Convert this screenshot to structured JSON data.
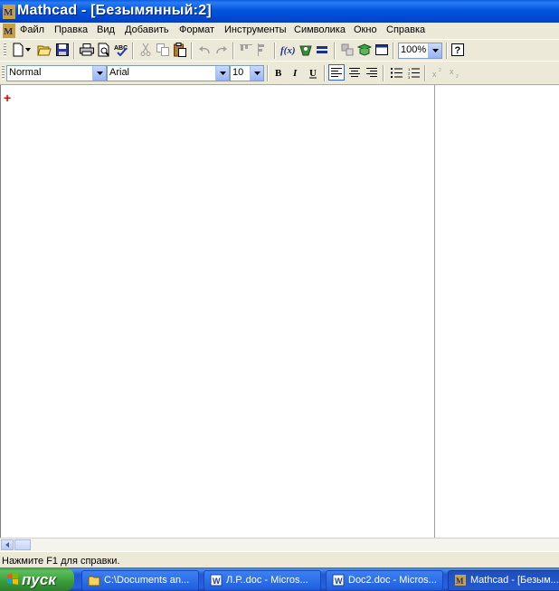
{
  "window": {
    "title": "Mathcad - [Безымянный:2]"
  },
  "menu": [
    "Файл",
    "Правка",
    "Вид",
    "Добавить",
    "Формат",
    "Инструменты",
    "Символика",
    "Окно",
    "Справка"
  ],
  "toolbar": {
    "zoom": "100%"
  },
  "format_bar": {
    "style": "Normal",
    "font": "Arial",
    "size": "10"
  },
  "status": {
    "text": "Нажмите F1 для справки."
  },
  "taskbar": {
    "start": "пуск",
    "tasks": [
      "C:\\Documents an...",
      "Л.Р..doc - Micros...",
      "Doc2.doc - Micros...",
      "Mathcad - [Безым..."
    ]
  },
  "colors": {
    "title_bar": "#0355dd",
    "taskbar": "#2663e0",
    "start_button": "#3a9d3a",
    "crosshair": "#e00000"
  }
}
